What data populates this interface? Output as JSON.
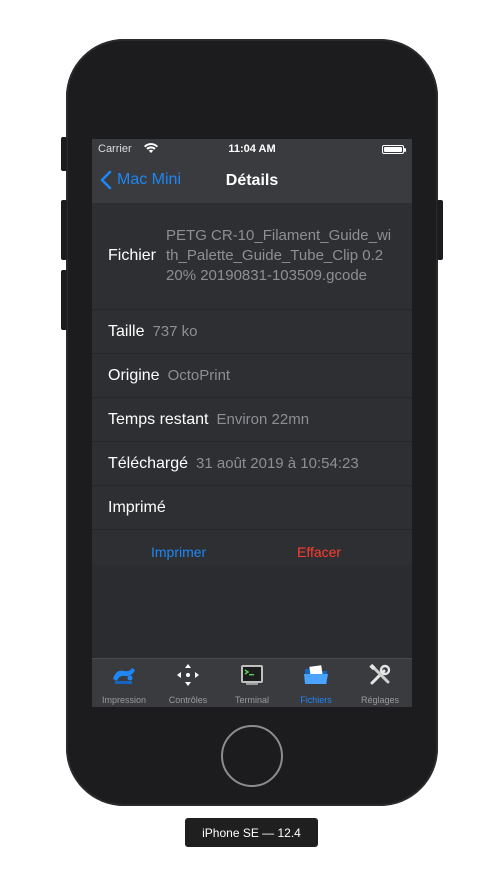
{
  "status_bar": {
    "carrier": "Carrier",
    "time": "11:04 AM"
  },
  "nav": {
    "back_label": "Mac Mini",
    "title": "Détails"
  },
  "details": {
    "file_label": "Fichier",
    "file_value": "PETG CR-10_Filament_Guide_with_Palette_Guide_Tube_Clip 0.2 20% 20190831-103509.gcode",
    "size_label": "Taille",
    "size_value": "737 ko",
    "origin_label": "Origine",
    "origin_value": "OctoPrint",
    "remaining_label": "Temps restant",
    "remaining_value": "Environ 22mn",
    "uploaded_label": "Téléchargé",
    "uploaded_value": "31 août 2019 à 10:54:23",
    "printed_label": "Imprimé"
  },
  "actions": {
    "print_label": "Imprimer",
    "delete_label": "Effacer"
  },
  "tabs": [
    {
      "label": "Impression",
      "icon": "printer-icon"
    },
    {
      "label": "Contrôles",
      "icon": "move-arrows-icon"
    },
    {
      "label": "Terminal",
      "icon": "terminal-icon"
    },
    {
      "label": "Fichiers",
      "icon": "folder-icon",
      "active": true
    },
    {
      "label": "Réglages",
      "icon": "tools-icon"
    }
  ],
  "device_label": "iPhone SE — 12.4",
  "colors": {
    "accent": "#1e86f5",
    "destructive": "#ff3b30",
    "background": "#2b2c30"
  }
}
